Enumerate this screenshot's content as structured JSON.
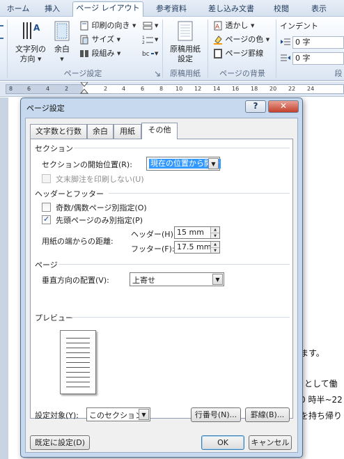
{
  "ribbon": {
    "tabs": [
      "ホーム",
      "挿入",
      "ページ レイアウト",
      "参考資料",
      "差し込み文書",
      "校閲",
      "表示"
    ],
    "active_tab": "ページ レイアウト",
    "text_direction_label_1": "文字列の",
    "text_direction_label_2": "方向",
    "margins_label": "余白",
    "orientation_label": "印刷の向き",
    "size_label": "サイズ",
    "columns_label": "段組み",
    "page_setup_group": "ページ設定",
    "manuscript_label_1": "原稿用紙",
    "manuscript_label_2": "設定",
    "manuscript_group": "原稿用紙",
    "watermark_label": "透かし",
    "page_color_label": "ページの色",
    "page_border_label": "ページ罫線",
    "background_group": "ページの背景",
    "indent_title": "インデント",
    "indent_left": "0 字",
    "indent_right": "0 字",
    "paragraph_group_partial": "段"
  },
  "ruler": {
    "numbers": [
      "8",
      "6",
      "4",
      "2",
      "2",
      "4",
      "6",
      "8",
      "10",
      "12",
      "14",
      "16",
      "18",
      "20",
      "22",
      "24"
    ]
  },
  "document": {
    "line1": "ます。",
    "line2": "として働",
    "line3": "0 時半~22",
    "line4": "を持ち帰り"
  },
  "dialog": {
    "title": "ページ設定",
    "help": "?",
    "close": "✕",
    "tabs": [
      "文字数と行数",
      "余白",
      "用紙",
      "その他"
    ],
    "active_tab": "その他",
    "section": {
      "title": "セクション",
      "start_label": "セクションの開始位置(R):",
      "start_value": "現在の位置から開始",
      "suppress_endnotes": "文末脚注を印刷しない(U)"
    },
    "headers_footers": {
      "title": "ヘッダーとフッター",
      "odd_even": "奇数/偶数ページ別指定(O)",
      "different_first": "先頭ページのみ別指定(P)",
      "from_edge": "用紙の端からの距離:",
      "header_label": "ヘッダー(H):",
      "header_value": "15 mm",
      "footer_label": "フッター(F):",
      "footer_value": "17.5 mm"
    },
    "page": {
      "title": "ページ",
      "valign_label": "垂直方向の配置(V):",
      "valign_value": "上寄せ"
    },
    "preview": {
      "title": "プレビュー"
    },
    "apply_to_label": "設定対象(Y):",
    "apply_to_value": "このセクション",
    "line_numbers_button": "行番号(N)...",
    "borders_button": "罫線(B)...",
    "default_button": "既定に設定(D)",
    "ok_button": "OK",
    "cancel_button": "キャンセル",
    "states": {
      "suppress_endnotes_checked": false,
      "odd_even_checked": false,
      "different_first_checked": true
    }
  }
}
